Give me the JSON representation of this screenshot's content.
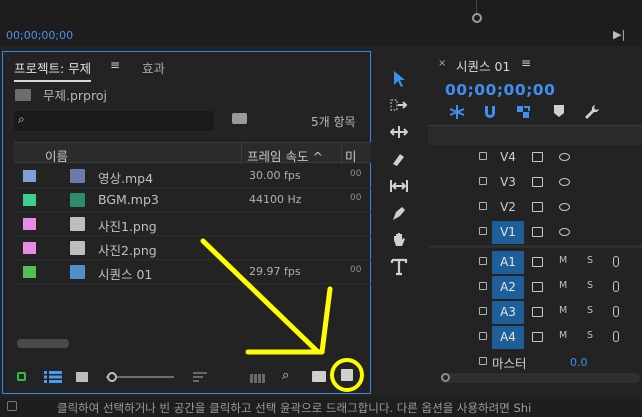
{
  "source_monitor": {
    "timecode": "00;00;00;00",
    "scrub_icon": "playhead-icon",
    "export_icon": "play-to-icon"
  },
  "project": {
    "tabs": [
      {
        "label": "프로젝트: 무제"
      },
      {
        "label": "효과"
      }
    ],
    "menu_icon": "menu-icon",
    "file_name": "무제.prproj",
    "search": {
      "value": "",
      "placeholder": ""
    },
    "item_count": "5개 항목",
    "columns": {
      "name": "이름",
      "fps": "프레임 속도 ^",
      "more": "미"
    },
    "items": [
      {
        "name": "영상.mp4",
        "fps": "30.00 fps",
        "more": "00",
        "swatch": "#7f9fd8",
        "icon": "video-file-icon"
      },
      {
        "name": "BGM.mp3",
        "fps": "44100 Hz",
        "more": "00",
        "swatch": "#3dce8d",
        "icon": "audio-file-icon"
      },
      {
        "name": "사진1.png",
        "fps": "",
        "more": "",
        "swatch": "#e78de4",
        "icon": "image-file-icon"
      },
      {
        "name": "사진2.png",
        "fps": "",
        "more": "",
        "swatch": "#e78de4",
        "icon": "image-file-icon"
      },
      {
        "name": "시퀀스 01",
        "fps": "29.97 fps",
        "more": "00",
        "swatch": "#55bf52",
        "icon": "sequence-icon"
      }
    ],
    "toolbar_icons": [
      "lock-icon",
      "list-view-icon",
      "icon-view-icon",
      "zoom-slider",
      "sort-icon",
      "automate-icon",
      "find-icon",
      "new-bin-icon",
      "new-item-icon"
    ]
  },
  "tools": [
    "selection-tool-icon",
    "track-select-icon",
    "ripple-edit-icon",
    "razor-icon",
    "slip-icon",
    "pen-icon",
    "hand-icon",
    "type-icon"
  ],
  "timeline": {
    "title": "시퀀스 01",
    "close": "×",
    "menu_icon": "menu-icon",
    "timecode": "00;00;00;00",
    "video_tracks": [
      "V4",
      "V3",
      "V2",
      "V1"
    ],
    "audio_tracks": [
      "A1",
      "A2",
      "A3",
      "A4"
    ],
    "mute_label": "M",
    "solo_label": "S",
    "master": {
      "label": "마스터",
      "value": "0.0"
    }
  },
  "status": {
    "text": "클릭하여 선택하거나 빈 공간을 클릭하고 선택 윤곽으로 드래그합니다. 다른 옵션을 사용하려면 Shi"
  },
  "colors": {
    "accent": "#2d8ceb",
    "timecode": "#3f8ff0",
    "selected_track": "#1e5f99",
    "annotation": "#ffff00",
    "lock_green": "#2fbf3f"
  }
}
